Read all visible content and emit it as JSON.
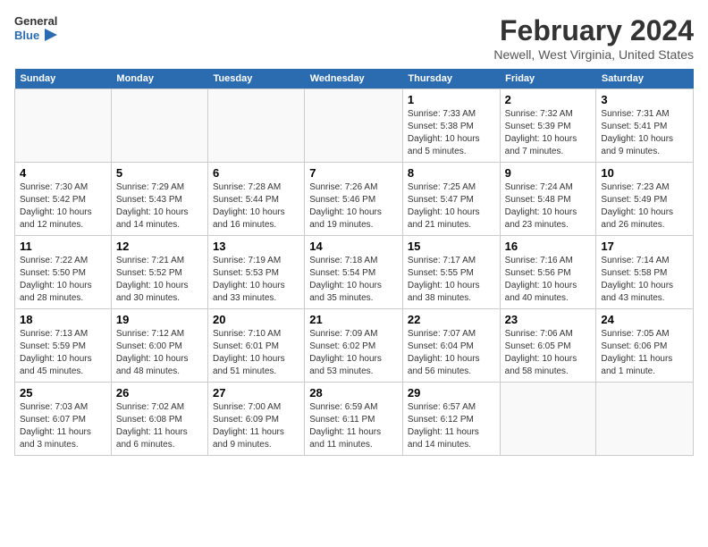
{
  "header": {
    "logo_line1": "General",
    "logo_line2": "Blue",
    "month_title": "February 2024",
    "location": "Newell, West Virginia, United States"
  },
  "days_of_week": [
    "Sunday",
    "Monday",
    "Tuesday",
    "Wednesday",
    "Thursday",
    "Friday",
    "Saturday"
  ],
  "weeks": [
    [
      {
        "day": "",
        "content": ""
      },
      {
        "day": "",
        "content": ""
      },
      {
        "day": "",
        "content": ""
      },
      {
        "day": "",
        "content": ""
      },
      {
        "day": "1",
        "content": "Sunrise: 7:33 AM\nSunset: 5:38 PM\nDaylight: 10 hours and 5 minutes."
      },
      {
        "day": "2",
        "content": "Sunrise: 7:32 AM\nSunset: 5:39 PM\nDaylight: 10 hours and 7 minutes."
      },
      {
        "day": "3",
        "content": "Sunrise: 7:31 AM\nSunset: 5:41 PM\nDaylight: 10 hours and 9 minutes."
      }
    ],
    [
      {
        "day": "4",
        "content": "Sunrise: 7:30 AM\nSunset: 5:42 PM\nDaylight: 10 hours and 12 minutes."
      },
      {
        "day": "5",
        "content": "Sunrise: 7:29 AM\nSunset: 5:43 PM\nDaylight: 10 hours and 14 minutes."
      },
      {
        "day": "6",
        "content": "Sunrise: 7:28 AM\nSunset: 5:44 PM\nDaylight: 10 hours and 16 minutes."
      },
      {
        "day": "7",
        "content": "Sunrise: 7:26 AM\nSunset: 5:46 PM\nDaylight: 10 hours and 19 minutes."
      },
      {
        "day": "8",
        "content": "Sunrise: 7:25 AM\nSunset: 5:47 PM\nDaylight: 10 hours and 21 minutes."
      },
      {
        "day": "9",
        "content": "Sunrise: 7:24 AM\nSunset: 5:48 PM\nDaylight: 10 hours and 23 minutes."
      },
      {
        "day": "10",
        "content": "Sunrise: 7:23 AM\nSunset: 5:49 PM\nDaylight: 10 hours and 26 minutes."
      }
    ],
    [
      {
        "day": "11",
        "content": "Sunrise: 7:22 AM\nSunset: 5:50 PM\nDaylight: 10 hours and 28 minutes."
      },
      {
        "day": "12",
        "content": "Sunrise: 7:21 AM\nSunset: 5:52 PM\nDaylight: 10 hours and 30 minutes."
      },
      {
        "day": "13",
        "content": "Sunrise: 7:19 AM\nSunset: 5:53 PM\nDaylight: 10 hours and 33 minutes."
      },
      {
        "day": "14",
        "content": "Sunrise: 7:18 AM\nSunset: 5:54 PM\nDaylight: 10 hours and 35 minutes."
      },
      {
        "day": "15",
        "content": "Sunrise: 7:17 AM\nSunset: 5:55 PM\nDaylight: 10 hours and 38 minutes."
      },
      {
        "day": "16",
        "content": "Sunrise: 7:16 AM\nSunset: 5:56 PM\nDaylight: 10 hours and 40 minutes."
      },
      {
        "day": "17",
        "content": "Sunrise: 7:14 AM\nSunset: 5:58 PM\nDaylight: 10 hours and 43 minutes."
      }
    ],
    [
      {
        "day": "18",
        "content": "Sunrise: 7:13 AM\nSunset: 5:59 PM\nDaylight: 10 hours and 45 minutes."
      },
      {
        "day": "19",
        "content": "Sunrise: 7:12 AM\nSunset: 6:00 PM\nDaylight: 10 hours and 48 minutes."
      },
      {
        "day": "20",
        "content": "Sunrise: 7:10 AM\nSunset: 6:01 PM\nDaylight: 10 hours and 51 minutes."
      },
      {
        "day": "21",
        "content": "Sunrise: 7:09 AM\nSunset: 6:02 PM\nDaylight: 10 hours and 53 minutes."
      },
      {
        "day": "22",
        "content": "Sunrise: 7:07 AM\nSunset: 6:04 PM\nDaylight: 10 hours and 56 minutes."
      },
      {
        "day": "23",
        "content": "Sunrise: 7:06 AM\nSunset: 6:05 PM\nDaylight: 10 hours and 58 minutes."
      },
      {
        "day": "24",
        "content": "Sunrise: 7:05 AM\nSunset: 6:06 PM\nDaylight: 11 hours and 1 minute."
      }
    ],
    [
      {
        "day": "25",
        "content": "Sunrise: 7:03 AM\nSunset: 6:07 PM\nDaylight: 11 hours and 3 minutes."
      },
      {
        "day": "26",
        "content": "Sunrise: 7:02 AM\nSunset: 6:08 PM\nDaylight: 11 hours and 6 minutes."
      },
      {
        "day": "27",
        "content": "Sunrise: 7:00 AM\nSunset: 6:09 PM\nDaylight: 11 hours and 9 minutes."
      },
      {
        "day": "28",
        "content": "Sunrise: 6:59 AM\nSunset: 6:11 PM\nDaylight: 11 hours and 11 minutes."
      },
      {
        "day": "29",
        "content": "Sunrise: 6:57 AM\nSunset: 6:12 PM\nDaylight: 11 hours and 14 minutes."
      },
      {
        "day": "",
        "content": ""
      },
      {
        "day": "",
        "content": ""
      }
    ]
  ]
}
